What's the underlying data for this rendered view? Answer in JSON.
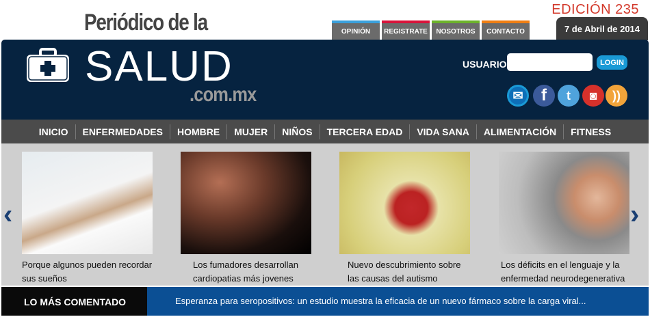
{
  "header": {
    "pre_title": "Periódico de la",
    "brand": "SALUD",
    "domain": ".com.mx",
    "edition": "EDICIÓN 235",
    "date": "7 de Abril de 2014"
  },
  "top_tabs": [
    {
      "label": "OPINIÓN",
      "color": "#3aa0dc"
    },
    {
      "label": "REGISTRATE",
      "color": "#d8133a"
    },
    {
      "label": "NOSOTROS",
      "color": "#6cb32a"
    },
    {
      "label": "CONTACTO",
      "color": "#f07e12"
    }
  ],
  "login": {
    "label": "USUARIO",
    "value": "",
    "button": "LOGIN"
  },
  "social": [
    {
      "icon": "mail-icon",
      "glyph": "✉",
      "color": "#0e6fb8"
    },
    {
      "icon": "facebook-icon",
      "glyph": "f",
      "color": "#3b5a9a"
    },
    {
      "icon": "twitter-icon",
      "glyph": "t",
      "color": "#4fa3dc"
    },
    {
      "icon": "instagram-icon",
      "glyph": "◙",
      "color": "#d6312b"
    },
    {
      "icon": "rss-icon",
      "glyph": "))",
      "color": "#f2a43a"
    }
  ],
  "nav": [
    "INICIO",
    "ENFERMEDADES",
    "HOMBRE",
    "MUJER",
    "NIÑOS",
    "TERCERA EDAD",
    "VIDA SANA",
    "ALIMENTACIÓN",
    "FITNESS"
  ],
  "carousel": [
    {
      "caption": "Porque algunos pueden recordar sus sueños"
    },
    {
      "caption": "Los fumadores desarrollan cardiopatias más jovenes"
    },
    {
      "caption": "Nuevo descubrimiento sobre las causas del autismo"
    },
    {
      "caption": "Los déficits en el lenguaje y la enfermedad neurodegenerativa"
    }
  ],
  "most_commented": {
    "label": "LO MÁS COMENTADO",
    "headline": "Esperanza para seropositivos: un estudio muestra la eficacia de un nuevo fármaco sobre la carga viral..."
  }
}
